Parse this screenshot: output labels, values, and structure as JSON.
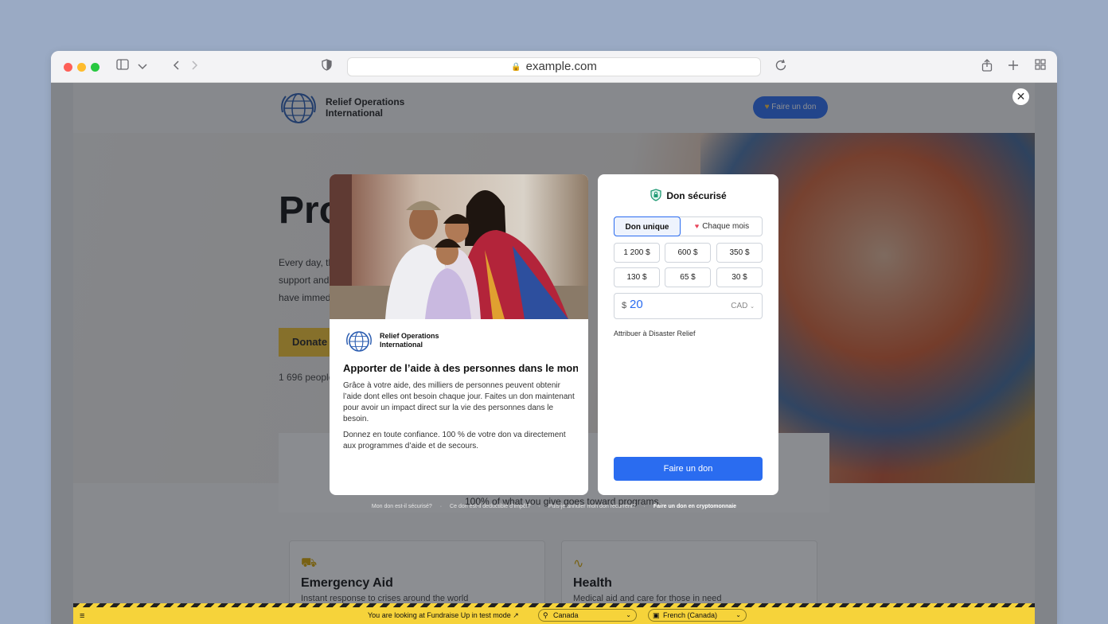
{
  "browser": {
    "url": "example.com"
  },
  "site": {
    "org_line1": "Relief Operations",
    "org_line2": "International",
    "header_donate": "Faire un don",
    "hero_title": "Pro",
    "hero_body": [
      "Every day, th",
      "support and",
      "have immed"
    ],
    "hero_button": "Donate n",
    "hero_count": "1 696 people",
    "below_sub": "100% of what you give goes toward programs.",
    "cards": [
      {
        "title": "Emergency Aid",
        "desc": "Instant response to crises around the world"
      },
      {
        "title": "Health",
        "desc": "Medical aid and care for those in need"
      }
    ]
  },
  "campaign": {
    "org_line1": "Relief Operations",
    "org_line2": "International",
    "title": "Apporter de l’aide à des personnes dans le mon...",
    "para1": "Grâce à votre aide, des milliers de personnes peuvent obtenir l’aide dont elles ont besoin chaque jour. Faites un don maintenant pour avoir un impact direct sur la vie des personnes dans le besoin.",
    "para2": "Donnez en toute confiance. 100 % de votre don va directement aux programmes d’aide et de secours."
  },
  "form": {
    "title": "Don sécurisé",
    "freq_once": "Don unique",
    "freq_monthly": "Chaque mois",
    "amounts": [
      "1 200 $",
      "600 $",
      "350 $",
      "130 $",
      "65 $",
      "30 $"
    ],
    "custom_symbol": "$",
    "custom_value": "20",
    "currency": "CAD",
    "designation": "Attribuer à Disaster Relief",
    "submit": "Faire un don"
  },
  "faq": {
    "q1": "Mon don est-il sécurisé?",
    "q2": "Ce don est-il déductible d’impôt?",
    "q3": "Puis-je annuler mon don récurrent?",
    "q4": "Faire un don en cryptomonnaie",
    "separator": "·"
  },
  "testbar": {
    "message": "You are looking at Fundraise Up in test mode",
    "country": "Canada",
    "language": "French (Canada)"
  },
  "colors": {
    "accent": "#2a6cf0",
    "test_yellow": "#f6d33a",
    "heart": "#e8455a"
  }
}
